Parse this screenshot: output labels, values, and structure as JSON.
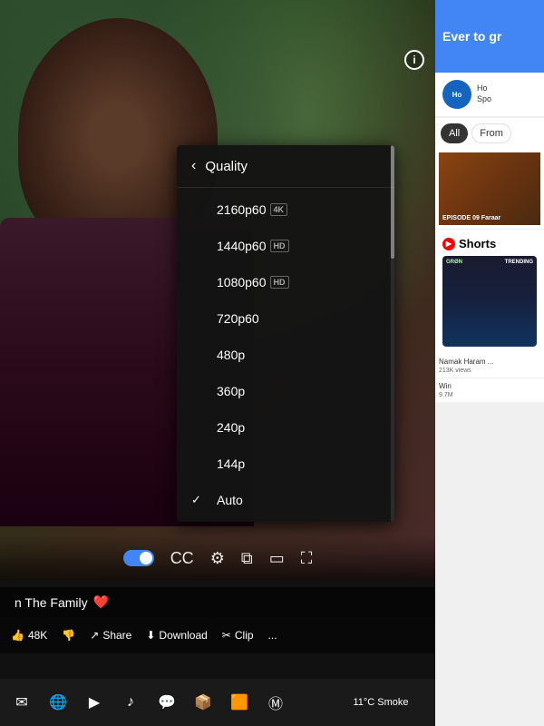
{
  "video": {
    "bg_gradient": "dark forest outdoor",
    "title": "n The Family",
    "heart": "❤️"
  },
  "quality_menu": {
    "title": "Quality",
    "back_label": "‹",
    "items": [
      {
        "id": "2160p60",
        "label": "2160p60",
        "badge": "4K",
        "badge_type": "4k",
        "selected": false
      },
      {
        "id": "1440p60",
        "label": "1440p60",
        "badge": "HD",
        "badge_type": "hd",
        "selected": false
      },
      {
        "id": "1080p60",
        "label": "1080p60",
        "badge": "HD",
        "badge_type": "hd",
        "selected": false
      },
      {
        "id": "720p60",
        "label": "720p60",
        "badge": "",
        "badge_type": "",
        "selected": false
      },
      {
        "id": "480p",
        "label": "480p",
        "badge": "",
        "badge_type": "",
        "selected": false
      },
      {
        "id": "360p",
        "label": "360p",
        "badge": "",
        "badge_type": "",
        "selected": false
      },
      {
        "id": "240p",
        "label": "240p",
        "badge": "",
        "badge_type": "",
        "selected": false
      },
      {
        "id": "144p",
        "label": "144p",
        "badge": "",
        "badge_type": "",
        "selected": false
      },
      {
        "id": "auto",
        "label": "Auto",
        "badge": "",
        "badge_type": "",
        "selected": true
      }
    ]
  },
  "controls": {
    "toggle_label": "",
    "cc_label": "CC",
    "settings_label": "⚙",
    "miniplayer_label": "⧉",
    "theater_label": "▭",
    "fullscreen_label": "⛶"
  },
  "actions": {
    "like_count": "48K",
    "share_label": "Share",
    "download_label": "Download",
    "clip_label": "Clip",
    "more_label": "..."
  },
  "sidebar": {
    "banner_text": "Ever to gr",
    "channel": {
      "name": "Ho",
      "subtitle": "Spo"
    },
    "filters": [
      {
        "label": "All",
        "active": true
      },
      {
        "label": "From",
        "active": false
      }
    ],
    "video_thumb": {
      "label": "EPISODE 09 Faraar",
      "badge": ""
    },
    "shorts": {
      "title": "Shorts",
      "thumb_label": "GRØN",
      "trending_label": "TRENDING"
    },
    "bottom_videos": [
      {
        "title": "Namak Haram ...",
        "meta": "213K views"
      },
      {
        "title": "Win",
        "meta": "9.7M"
      }
    ]
  },
  "taskbar": {
    "icons": [
      "✉",
      "🌐",
      "▶",
      "♪",
      "💬",
      "📦",
      "🟧",
      "Ⓜ"
    ],
    "weather": "11°C Smoke"
  },
  "info_button": "i"
}
